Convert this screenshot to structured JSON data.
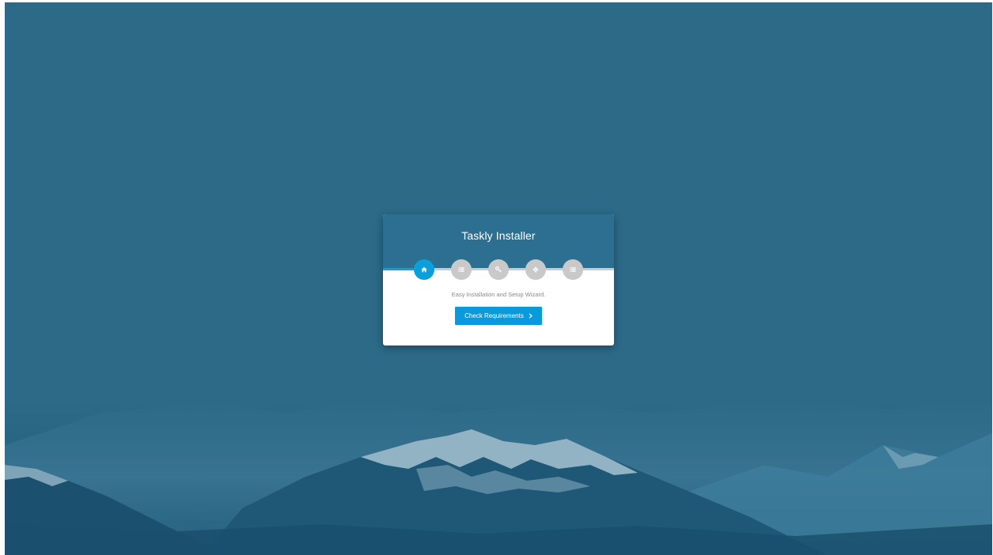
{
  "installer": {
    "title": "Taskly Installer",
    "subtitle": "Easy Installation and Setup Wizard.",
    "primary_button": {
      "label": "Check Requirements",
      "icon": "chevron-right-icon"
    },
    "steps": [
      {
        "icon": "home-icon",
        "state": "active"
      },
      {
        "icon": "list-icon",
        "state": "inactive"
      },
      {
        "icon": "key-icon",
        "state": "inactive"
      },
      {
        "icon": "gear-icon",
        "state": "inactive"
      },
      {
        "icon": "list-icon",
        "state": "inactive"
      }
    ],
    "current_step": 1,
    "total_steps": 5
  },
  "colors": {
    "background": "#2c6a88",
    "header": "#2c6f91",
    "accent": "#0ba0dc",
    "button": "#0a99db",
    "inactive_step": "#c9c9c9",
    "subtitle_text": "#8a8a8a"
  },
  "background_image": "snowy-mountain-range"
}
